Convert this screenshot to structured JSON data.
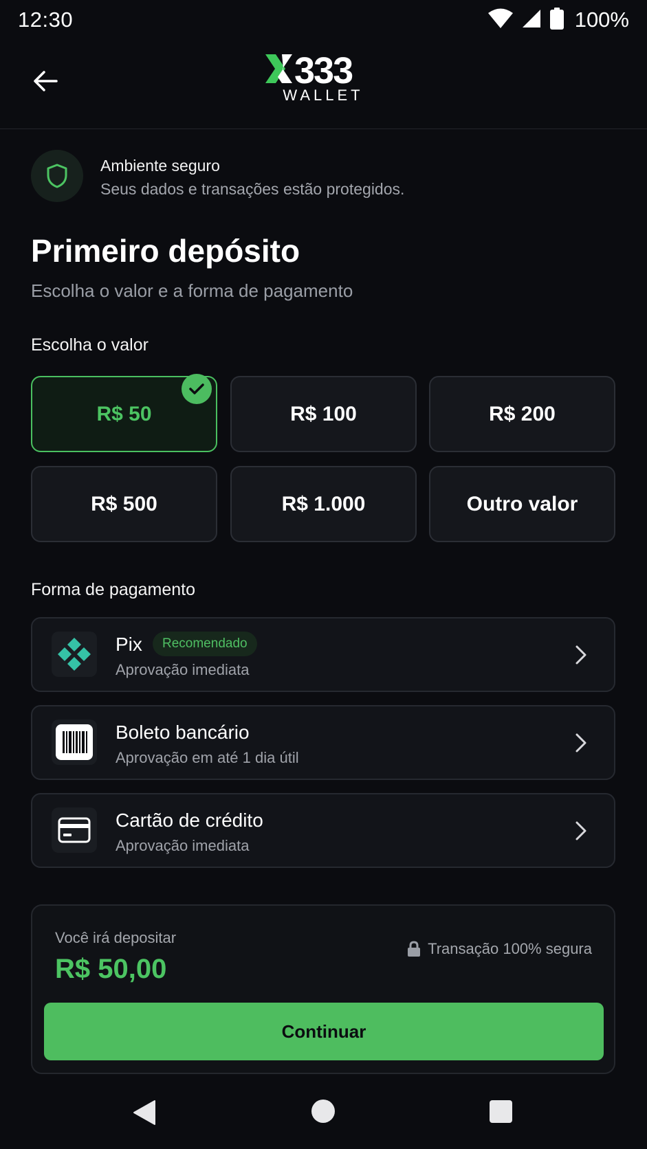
{
  "status_bar": {
    "time": "12:30",
    "battery": "100%",
    "icons": [
      "wifi-icon",
      "signal-icon",
      "battery-icon"
    ]
  },
  "header": {
    "back_icon": "arrow-left-icon",
    "logo_mark": "X333",
    "logo_word": "WALLET"
  },
  "secure_banner": {
    "icon": "shield-icon",
    "title": "Ambiente seguro",
    "subtitle": "Seus dados e transações estão protegidos."
  },
  "page": {
    "title": "Primeiro depósito",
    "subtitle": "Escolha o valor e a forma de pagamento"
  },
  "amount_section": {
    "label": "Escolha o valor",
    "options": [
      {
        "label": "R$ 50",
        "selected": true
      },
      {
        "label": "R$ 100",
        "selected": false
      },
      {
        "label": "R$ 200",
        "selected": false
      },
      {
        "label": "R$ 500",
        "selected": false
      },
      {
        "label": "R$ 1.000",
        "selected": false
      },
      {
        "label": "Outro valor",
        "selected": false
      }
    ]
  },
  "payment_section": {
    "label": "Forma de pagamento",
    "methods": [
      {
        "title": "Pix",
        "badge": "Recomendado",
        "subtitle": "Aprovação imediata",
        "icon": "pix-icon"
      },
      {
        "title": "Boleto bancário",
        "subtitle": "Aprovação em até 1 dia útil",
        "icon": "barcode-icon"
      },
      {
        "title": "Cartão de crédito",
        "subtitle": "Aprovação imediata",
        "icon": "credit-card-icon"
      }
    ]
  },
  "summary": {
    "label": "Você irá depositar",
    "amount": "R$ 50,00",
    "secure_text": "Transação 100% segura",
    "button": "Continuar"
  },
  "colors": {
    "background": "#0b0c10",
    "accent": "#4cc462",
    "card": "#15171c",
    "border": "#2b2e35",
    "muted_text": "#a0a3aa"
  }
}
